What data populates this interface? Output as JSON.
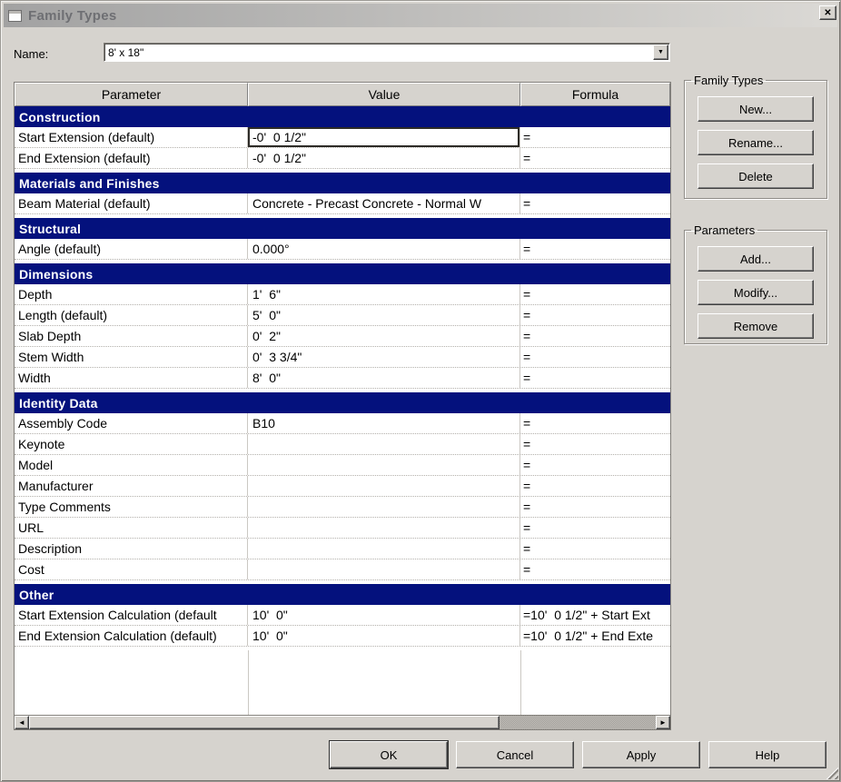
{
  "window": {
    "title": "Family Types"
  },
  "icons": {
    "close": "✕",
    "dropdown": "▼",
    "scroll_left": "◄",
    "scroll_right": "►"
  },
  "name_field": {
    "label": "Name:",
    "value": "8' x 18\""
  },
  "table": {
    "columns": [
      "Parameter",
      "Value",
      "Formula"
    ],
    "sections": [
      {
        "title": "Construction",
        "rows": [
          {
            "parameter": "Start Extension (default)",
            "value": "-0'  0 1/2\"",
            "formula": "=",
            "selected": true
          },
          {
            "parameter": "End Extension (default)",
            "value": "-0'  0 1/2\"",
            "formula": "="
          }
        ]
      },
      {
        "title": "Materials and Finishes",
        "rows": [
          {
            "parameter": "Beam Material (default)",
            "value": "Concrete - Precast Concrete - Normal W",
            "formula": "="
          }
        ]
      },
      {
        "title": "Structural",
        "rows": [
          {
            "parameter": "Angle (default)",
            "value": "0.000°",
            "formula": "="
          }
        ]
      },
      {
        "title": "Dimensions",
        "rows": [
          {
            "parameter": "Depth",
            "value": "1'  6\"",
            "formula": "="
          },
          {
            "parameter": "Length (default)",
            "value": "5'  0\"",
            "formula": "="
          },
          {
            "parameter": "Slab Depth",
            "value": "0'  2\"",
            "formula": "="
          },
          {
            "parameter": "Stem Width",
            "value": "0'  3 3/4\"",
            "formula": "="
          },
          {
            "parameter": "Width",
            "value": "8'  0\"",
            "formula": "="
          }
        ]
      },
      {
        "title": "Identity Data",
        "rows": [
          {
            "parameter": "Assembly Code",
            "value": "B10",
            "formula": "="
          },
          {
            "parameter": "Keynote",
            "value": "",
            "formula": "="
          },
          {
            "parameter": "Model",
            "value": "",
            "formula": "="
          },
          {
            "parameter": "Manufacturer",
            "value": "",
            "formula": "="
          },
          {
            "parameter": "Type Comments",
            "value": "",
            "formula": "="
          },
          {
            "parameter": "URL",
            "value": "",
            "formula": "="
          },
          {
            "parameter": "Description",
            "value": "",
            "formula": "="
          },
          {
            "parameter": "Cost",
            "value": "",
            "formula": "="
          }
        ]
      },
      {
        "title": "Other",
        "rows": [
          {
            "parameter": "Start Extension Calculation (default",
            "value": "10'  0\"",
            "formula": "=10'  0 1/2\" + Start Ext"
          },
          {
            "parameter": "End Extension Calculation (default)",
            "value": "10'  0\"",
            "formula": "=10'  0 1/2\" + End Exte"
          }
        ]
      }
    ]
  },
  "family_types_group": {
    "title": "Family Types",
    "buttons": [
      "New...",
      "Rename...",
      "Delete"
    ]
  },
  "parameters_group": {
    "title": "Parameters",
    "buttons": [
      "Add...",
      "Modify...",
      "Remove"
    ]
  },
  "footer_buttons": [
    "OK",
    "Cancel",
    "Apply",
    "Help"
  ],
  "colors": {
    "dialog_bg": "#d6d3ce",
    "section_header_bg": "#04117d",
    "section_header_text": "#ffffff"
  }
}
